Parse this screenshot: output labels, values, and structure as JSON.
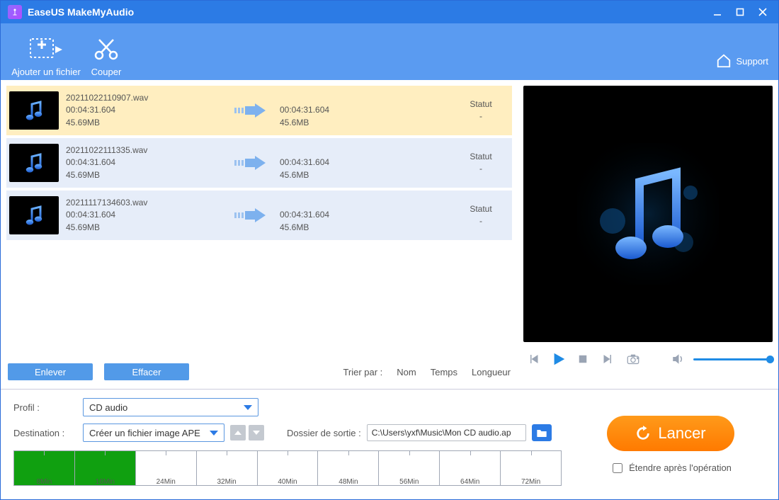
{
  "titlebar": {
    "title": "EaseUS MakeMyAudio"
  },
  "toolbar": {
    "add_label": "Ajouter un fichier",
    "cut_label": "Couper",
    "support_label": "Support"
  },
  "sort": {
    "label": "Trier par :",
    "opts": [
      "Nom",
      "Temps",
      "Longueur"
    ]
  },
  "buttons": {
    "remove": "Enlever",
    "clear": "Effacer",
    "launch": "Lancer",
    "shutdown": "Étendre après l'opération"
  },
  "files": [
    {
      "name": "20211022110907.wav",
      "dur": "00:04:31.604",
      "size": "45.69MB",
      "out_dur": "00:04:31.604",
      "out_size": "45.6MB",
      "status_label": "Statut",
      "status_val": "-",
      "selected": true
    },
    {
      "name": "20211022111335.wav",
      "dur": "00:04:31.604",
      "size": "45.69MB",
      "out_dur": "00:04:31.604",
      "out_size": "45.6MB",
      "status_label": "Statut",
      "status_val": "-",
      "selected": false
    },
    {
      "name": "20211117134603.wav",
      "dur": "00:04:31.604",
      "size": "45.69MB",
      "out_dur": "00:04:31.604",
      "out_size": "45.6MB",
      "status_label": "Statut",
      "status_val": "-",
      "selected": false
    }
  ],
  "profile": {
    "label": "Profil :",
    "value": "CD audio"
  },
  "destination": {
    "label": "Destination :",
    "value": "Créer un fichier image APE"
  },
  "output_folder": {
    "label": "Dossier de sortie :",
    "value": "C:\\Users\\yxf\\Music\\Mon CD audio.ap"
  },
  "timeline": [
    "8Min",
    "16Min",
    "24Min",
    "32Min",
    "40Min",
    "48Min",
    "56Min",
    "64Min",
    "72Min"
  ]
}
